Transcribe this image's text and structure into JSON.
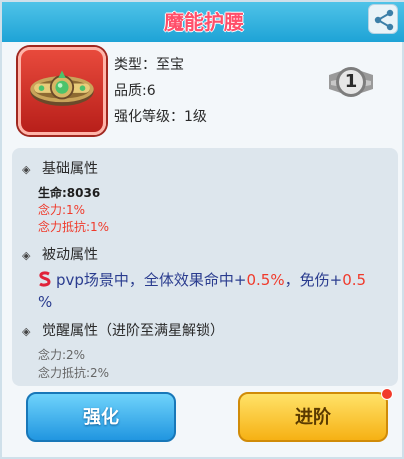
{
  "title": "魔能护腰",
  "item": {
    "type_line": "类型：至宝",
    "quality_line": "品质:6",
    "level_line": "强化等级：1级",
    "rank": "1"
  },
  "base_attrs": {
    "heading": "基础属性",
    "lines": [
      "生命:8036",
      "念力:1%",
      "念力抵抗:1%"
    ]
  },
  "passive": {
    "heading": "被动属性",
    "text_a": "pvp场景中，全体效果命中+",
    "num_a": "0.5%",
    "text_b": "，免伤+",
    "num_b": "0.5",
    "text_c": "%"
  },
  "awaken": {
    "heading": "觉醒属性（进阶至满星解锁）",
    "lines": [
      "念力:2%",
      "念力抵抗:2%"
    ]
  },
  "buttons": {
    "strengthen": "强化",
    "advance": "进阶"
  }
}
